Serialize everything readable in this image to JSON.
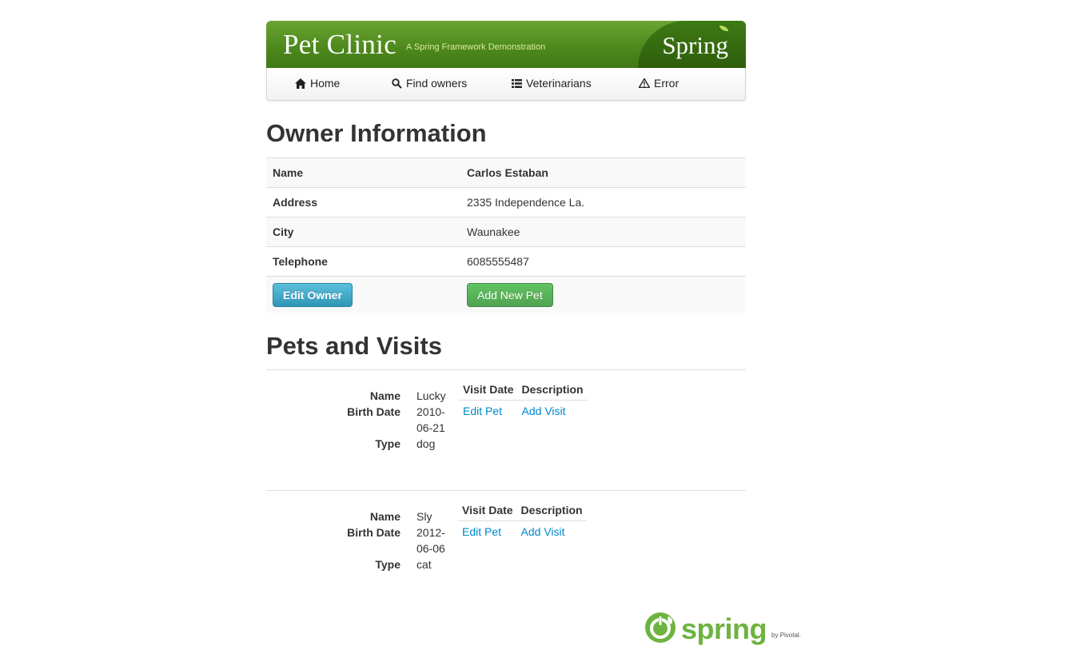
{
  "banner": {
    "title": "Pet Clinic",
    "subtitle": "A Spring Framework Demonstration",
    "logo_text": "Spring"
  },
  "nav": {
    "items": [
      {
        "label": "Home",
        "icon": "home-icon"
      },
      {
        "label": "Find owners",
        "icon": "search-icon"
      },
      {
        "label": "Veterinarians",
        "icon": "list-icon"
      },
      {
        "label": "Error",
        "icon": "warning-icon"
      }
    ]
  },
  "owner": {
    "heading": "Owner Information",
    "rows": [
      {
        "label": "Name",
        "value": "Carlos Estaban"
      },
      {
        "label": "Address",
        "value": "2335 Independence La."
      },
      {
        "label": "City",
        "value": "Waunakee"
      },
      {
        "label": "Telephone",
        "value": "6085555487"
      }
    ],
    "edit_button": "Edit Owner",
    "add_pet_button": "Add New Pet"
  },
  "pets": {
    "heading": "Pets and Visits",
    "labels": {
      "name": "Name",
      "birth_date": "Birth Date",
      "type": "Type"
    },
    "visit_headers": {
      "date": "Visit Date",
      "description": "Description"
    },
    "edit_pet": "Edit Pet",
    "add_visit": "Add Visit",
    "items": [
      {
        "name": "Lucky",
        "birth_date_1": "2010-",
        "birth_date_2": "06-21",
        "type": "dog"
      },
      {
        "name": "Sly",
        "birth_date_1": "2012-",
        "birth_date_2": "06-06",
        "type": "cat"
      }
    ]
  },
  "footer": {
    "logo_word": "spring",
    "logo_by": "by Pivotal."
  },
  "colors": {
    "brand_green": "#6db33f",
    "link": "#0088cc",
    "btn_info": "#2f96b4",
    "btn_success": "#51a351"
  }
}
